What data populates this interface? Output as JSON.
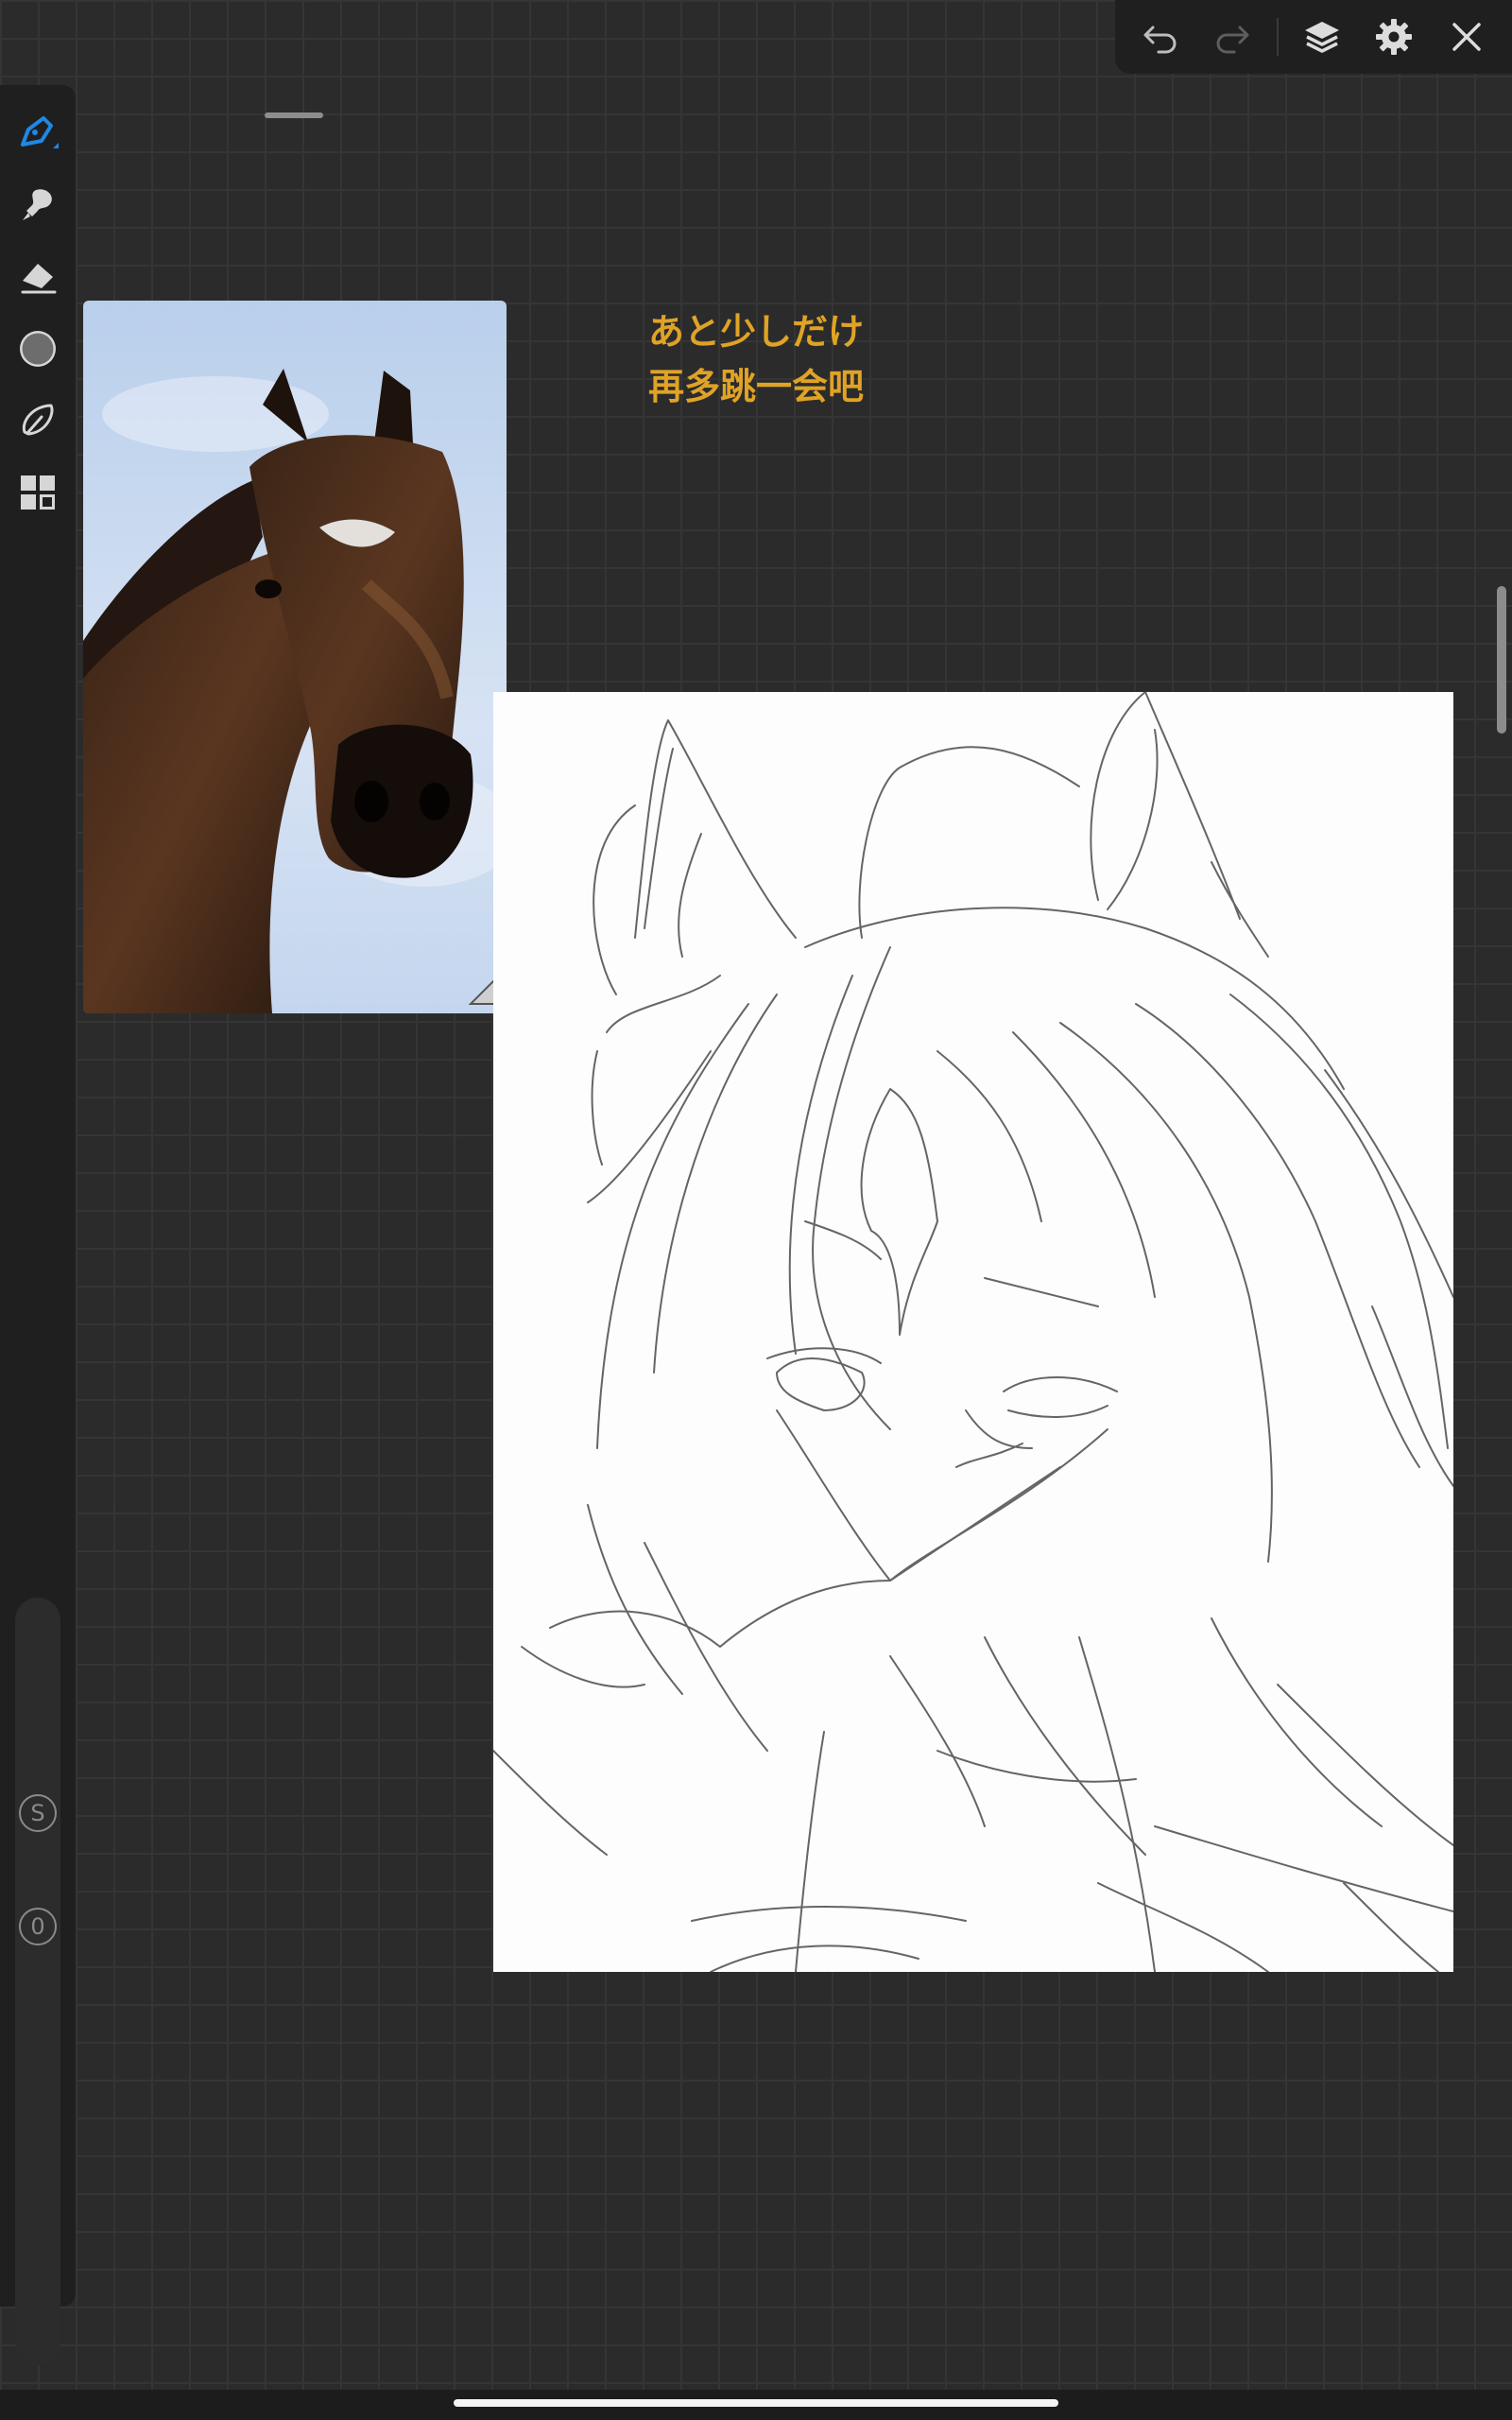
{
  "top_toolbar": {
    "undo_icon": "undo-icon",
    "redo_icon": "redo-icon",
    "layers_icon": "layers-icon",
    "settings_icon": "gear-icon",
    "close_icon": "close-icon"
  },
  "side_toolbar": {
    "tools": [
      "pen-tool-icon",
      "smudge-icon",
      "eraser-icon",
      "color-icon",
      "lasso-icon",
      "grid-icon"
    ],
    "current_color": "#6d6d6d",
    "accent": "#1e88e5",
    "badges": {
      "stabilizer": "S",
      "opacity": "0"
    }
  },
  "reference": {
    "subject": "horse-photo"
  },
  "caption": {
    "line1": "あと少しだけ",
    "line2": "再多跳一会吧",
    "color": "#e0a325"
  }
}
